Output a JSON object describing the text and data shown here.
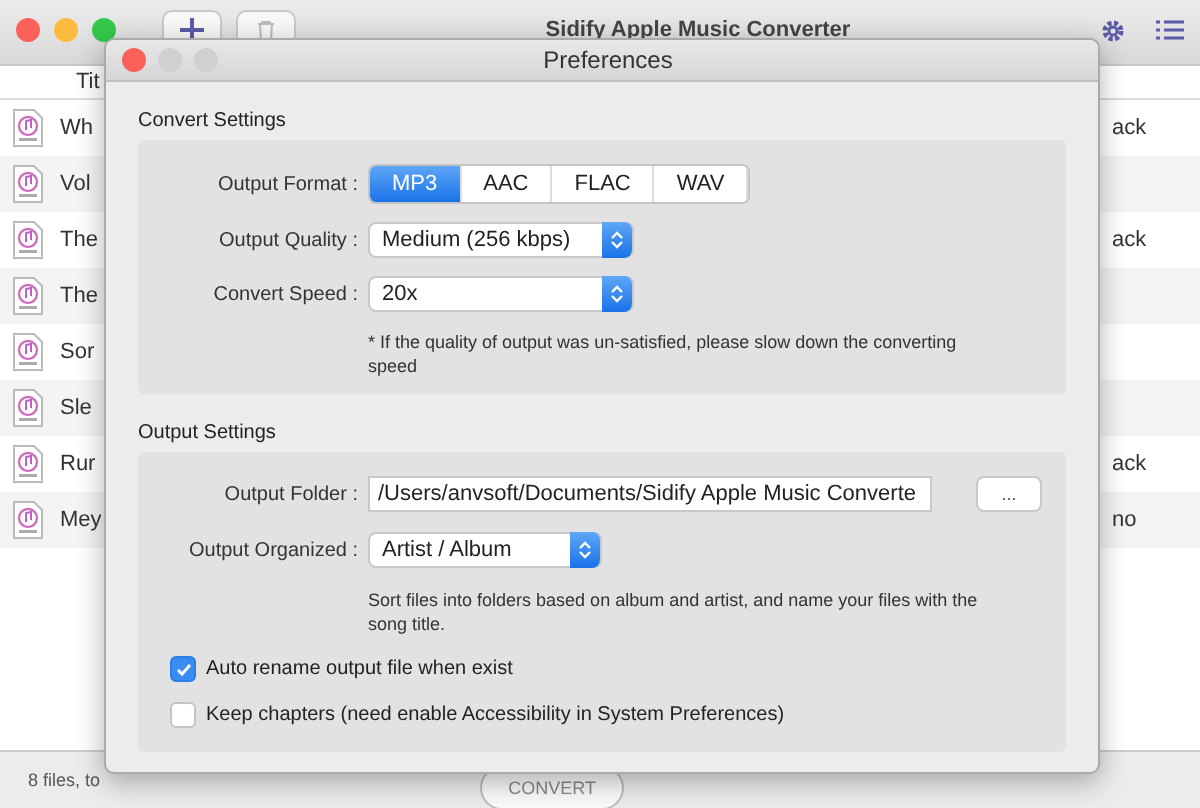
{
  "app": {
    "title": "Sidify Apple Music Converter",
    "column_header": "Tit",
    "rows": [
      {
        "title": "Wh",
        "column_2": "ack"
      },
      {
        "title": "Vol"
      },
      {
        "title": "The",
        "column_2": "ack"
      },
      {
        "title": "The"
      },
      {
        "title": "Sor"
      },
      {
        "title": "Sle"
      },
      {
        "title": "Rur",
        "column_2": "ack"
      },
      {
        "title": "Mey",
        "column_2": "no"
      }
    ],
    "status": "8 files, to",
    "convert_button": "CONVERT"
  },
  "dialog": {
    "title": "Preferences",
    "convert_settings": {
      "heading": "Convert Settings",
      "format_label": "Output Format :",
      "formats": [
        {
          "label": "MP3",
          "selected": true
        },
        {
          "label": "AAC",
          "selected": false
        },
        {
          "label": "FLAC",
          "selected": false
        },
        {
          "label": "WAV",
          "selected": false
        }
      ],
      "quality_label": "Output Quality :",
      "quality": "Medium (256 kbps)",
      "speed_label": "Convert Speed :",
      "speed": "20x",
      "note": "* If the quality of output was un-satisfied, please slow down the converting speed"
    },
    "output_settings": {
      "heading": "Output Settings",
      "folder_label": "Output Folder :",
      "folder": "/Users/anvsoft/Documents/Sidify Apple Music Converte",
      "browse_button": "...",
      "organized_label": "Output Organized :",
      "organized": "Artist / Album",
      "note": "Sort files into folders based on album and artist, and name your files with the song title.",
      "checkboxes": [
        {
          "label": "Auto rename output file when exist",
          "checked": true
        },
        {
          "label": "Keep chapters (need enable Accessibility in System Preferences)",
          "checked": false
        }
      ]
    }
  }
}
